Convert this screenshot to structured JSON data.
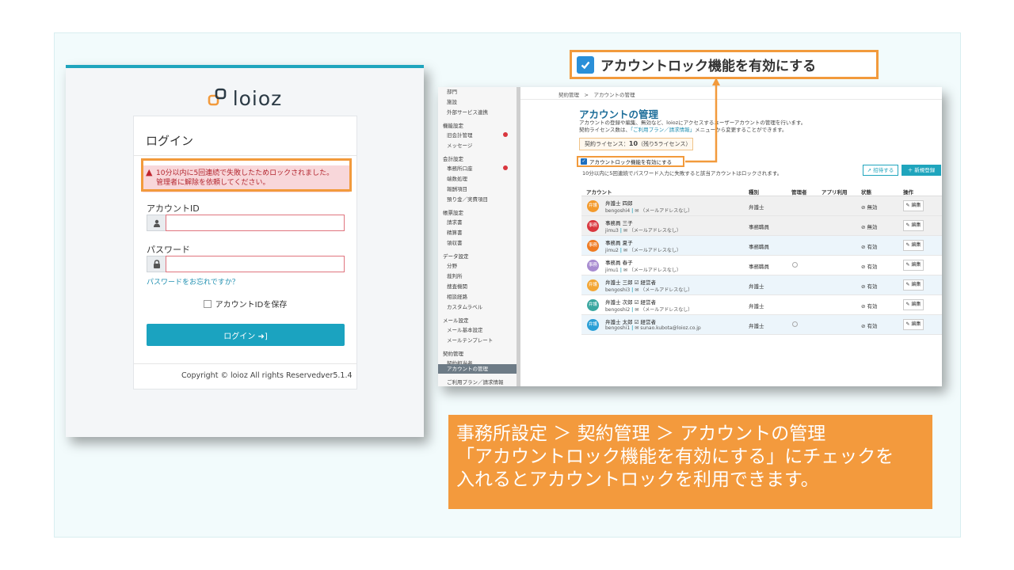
{
  "login": {
    "logo_text": "loioz",
    "title": "ログイン",
    "alert_line1": "10分以内に5回連続で失敗したためロックされました。",
    "alert_line2": "管理者に解除を依頼してください。",
    "account_id_label": "アカウントID",
    "password_label": "パスワード",
    "forgot_link": "パスワードをお忘れですか？",
    "remember_label": "アカウントIDを保存",
    "login_button": "ログイン ➜]",
    "copyright": "Copyright © loioz All rights Reserved.",
    "version": "ver5.1.4"
  },
  "sidebar": {
    "items": [
      {
        "label": "部門",
        "type": "item"
      },
      {
        "label": "施設",
        "type": "item"
      },
      {
        "label": "外部サービス連携",
        "type": "item"
      },
      {
        "label": "機能設定",
        "type": "head"
      },
      {
        "label": "旧会計管理",
        "type": "item",
        "badge": true
      },
      {
        "label": "メッセージ",
        "type": "item"
      },
      {
        "label": "会計設定",
        "type": "head"
      },
      {
        "label": "事務所口座",
        "type": "item",
        "badge": true
      },
      {
        "label": "端数処理",
        "type": "item"
      },
      {
        "label": "報酬項目",
        "type": "item"
      },
      {
        "label": "預り金／実費項目",
        "type": "item"
      },
      {
        "label": "帳票設定",
        "type": "head"
      },
      {
        "label": "請求書",
        "type": "item"
      },
      {
        "label": "精算書",
        "type": "item"
      },
      {
        "label": "領収書",
        "type": "item"
      },
      {
        "label": "データ設定",
        "type": "head"
      },
      {
        "label": "分野",
        "type": "item"
      },
      {
        "label": "裁判所",
        "type": "item"
      },
      {
        "label": "捜査機関",
        "type": "item"
      },
      {
        "label": "相談経路",
        "type": "item"
      },
      {
        "label": "カスタムラベル",
        "type": "item"
      },
      {
        "label": "メール設定",
        "type": "head"
      },
      {
        "label": "メール基本設定",
        "type": "item"
      },
      {
        "label": "メールテンプレート",
        "type": "item"
      },
      {
        "label": "契約管理",
        "type": "head"
      },
      {
        "label": "契約担当者",
        "type": "item"
      },
      {
        "label": "アカウントの管理",
        "type": "active"
      },
      {
        "label": "ご利用プラン／請求情報",
        "type": "item"
      }
    ]
  },
  "admin": {
    "breadcrumb": "契約管理　>　アカウントの管理",
    "title": "アカウントの管理",
    "desc1": "アカウントの登録や編集、無効など、loiozにアクセスするユーザーアカウントの管理を行います。",
    "desc2_a": "契約ライセンス数は、",
    "desc2_link": "「ご利用プラン／請求情報」",
    "desc2_b": "メニューから変更することができます。",
    "license_label": "契約ライセンス：",
    "license_count": "10",
    "license_rest": "（残り5ライセンス）",
    "lock_checkbox_label": "アカウントロック機能を有効にする",
    "lock_note": "10分以内に5回連続でパスワード入力に失敗すると該当アカウントはロックされます。",
    "invite_button": "招待する",
    "new_button": "＋ 新規登録",
    "columns": [
      "アカウント",
      "種別",
      "管理者",
      "アプリ利用",
      "状態",
      "操作"
    ],
    "rows": [
      {
        "avatar": "弁護",
        "avatar_color": "#f39a2b",
        "name": "弁護士 四郎",
        "badge": "",
        "uid": "bengoshi4",
        "mail": "（メールアドレスなし）",
        "kind": "弁護士",
        "admin": false,
        "status": "⊘ 無効",
        "edit": "編集",
        "shade": "grey"
      },
      {
        "avatar": "事務",
        "avatar_color": "#d9363e",
        "name": "事務員 三子",
        "badge": "",
        "uid": "jimu3",
        "mail": "（メールアドレスなし）",
        "kind": "事務職員",
        "admin": false,
        "status": "⊘ 無効",
        "edit": "編集",
        "shade": "grey"
      },
      {
        "avatar": "事務",
        "avatar_color": "#ef7b22",
        "name": "事務員 夏子",
        "badge": "",
        "uid": "jimu2",
        "mail": "（メールアドレスなし）",
        "kind": "事務職員",
        "admin": false,
        "status": "⊘ 有効",
        "edit": "編集",
        "shade": "blue"
      },
      {
        "avatar": "事務",
        "avatar_color": "#a78bd0",
        "name": "事務員 春子",
        "badge": "",
        "uid": "jimu1",
        "mail": "（メールアドレスなし）",
        "kind": "事務職員",
        "admin": true,
        "status": "⊘ 有効",
        "edit": "編集",
        "shade": "white"
      },
      {
        "avatar": "弁護",
        "avatar_color": "#f3a634",
        "name": "弁護士 三郎",
        "badge": "☑ 経営者",
        "uid": "bengoshi3",
        "mail": "（メールアドレスなし）",
        "kind": "弁護士",
        "admin": false,
        "status": "⊘ 有効",
        "edit": "編集",
        "shade": "blue"
      },
      {
        "avatar": "弁護",
        "avatar_color": "#3aa7a0",
        "name": "弁護士 次郎",
        "badge": "☑ 経営者",
        "uid": "bengoshi2",
        "mail": "（メールアドレスなし）",
        "kind": "弁護士",
        "admin": false,
        "status": "⊘ 有効",
        "edit": "編集",
        "shade": "white"
      },
      {
        "avatar": "弁護",
        "avatar_color": "#2a9fd6",
        "name": "弁護士 太郎",
        "badge": "☑ 経営者",
        "uid": "bengoshi1",
        "mail": "sunao.kubota@loioz.co.jp",
        "kind": "弁護士",
        "admin": true,
        "status": "⊘ 有効",
        "edit": "編集",
        "shade": "blue"
      }
    ]
  },
  "callout": {
    "text": "アカウントロック機能を有効にする"
  },
  "info": {
    "line1": "事務所設定 ＞ 契約管理 ＞ アカウントの管理",
    "line2": "「アカウントロック機能を有効にする」にチェックを",
    "line3": "入れるとアカウントロックを利用できます。"
  },
  "colors": {
    "accent": "#1fa5bd",
    "highlight": "#f29a3c",
    "info_bg": "#f39a3d"
  }
}
